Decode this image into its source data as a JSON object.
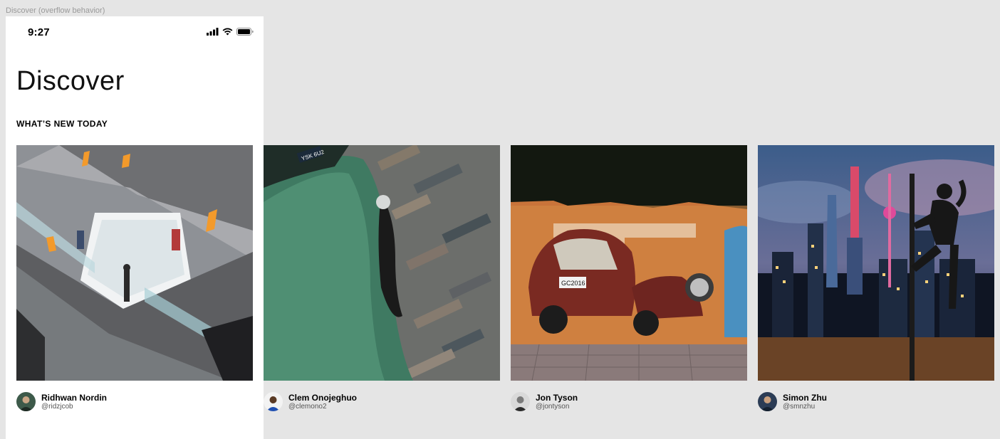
{
  "frame": {
    "label": "Discover (overflow behavior)"
  },
  "status_bar": {
    "time": "9:27",
    "icons": [
      "signal-icon",
      "wifi-icon",
      "battery-icon"
    ]
  },
  "page": {
    "title": "Discover",
    "section_title": "WHAT’S NEW TODAY"
  },
  "cards": [
    {
      "image": "escalator-photo",
      "name": "Ridhwan Nordin",
      "handle": "@ridzjcob"
    },
    {
      "image": "green-car-photo",
      "name": "Clem Onojeghuo",
      "handle": "@clemono2"
    },
    {
      "image": "graffiti-car-scooter-photo",
      "name": "Jon Tyson",
      "handle": "@jontyson"
    },
    {
      "image": "city-night-climber-photo",
      "name": "Simon Zhu",
      "handle": "@smnzhu"
    }
  ],
  "colors": {
    "canvas": "#e5e5e5",
    "phone_bg": "#ffffff",
    "text": "#000000",
    "muted": "#555555"
  }
}
